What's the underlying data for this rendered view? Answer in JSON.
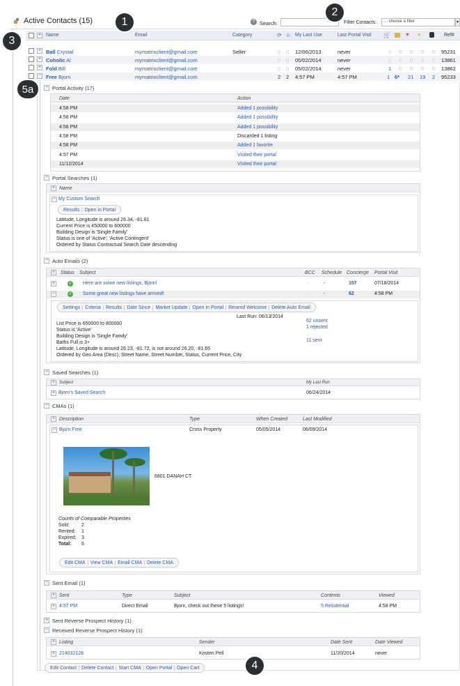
{
  "window": {
    "title": "Active Contacts (15)"
  },
  "search": {
    "label": "Search:",
    "value": ""
  },
  "filter": {
    "label": "Filter Contacts:",
    "selected": "... choose a filter"
  },
  "badges": [
    "1",
    "2",
    "3",
    "4",
    "5a"
  ],
  "columns": {
    "name": "Name",
    "email": "Email",
    "category": "Category",
    "my_last_use": "My Last Use",
    "last_portal_visit": "Last Portal Visit",
    "ref": "Ref#"
  },
  "contacts": [
    {
      "last": "Ball",
      "first": "Crystal",
      "email": "mymatrixclient@gmail.com",
      "category": "Seller",
      "c1": "0",
      "c2": "0",
      "my_last_use": "12/06/2013",
      "last_visit": "never",
      "s1": "0",
      "s2": "0",
      "s3": "0",
      "s4": "0",
      "s5": "0",
      "ref": "95231"
    },
    {
      "last": "Coholic",
      "first": "Al",
      "email": "mymatrixclient@gmail.com",
      "category": "",
      "c1": "0",
      "c2": "0",
      "my_last_use": "05/02/2014",
      "last_visit": "never",
      "s1": "0",
      "s2": "0",
      "s3": "0",
      "s4": "0",
      "s5": "0",
      "ref": "13861"
    },
    {
      "last": "Fold",
      "first": "Bill",
      "email": "mymatrixclient@gmail.com",
      "category": "",
      "c1": "0",
      "c2": "0",
      "my_last_use": "05/02/2014",
      "last_visit": "never",
      "s1": "1",
      "s2": "0",
      "s3": "0",
      "s4": "0",
      "s5": "0",
      "ref": "13862"
    },
    {
      "last": "Free",
      "first": "Bjorn",
      "email": "mymatrixclient@gmail.com",
      "category": "",
      "c1": "2",
      "c2": "2",
      "my_last_use": "4:57 PM",
      "last_visit": "4:57 PM",
      "s1": "1",
      "s2": "6*",
      "s3": "21",
      "s4": "19",
      "s5": "2",
      "ref": "95233"
    }
  ],
  "portal_activity": {
    "heading": "Portal Activity (17)",
    "col_date": "Date",
    "col_action": "Action",
    "rows": [
      {
        "date": "4:58 PM",
        "action": "Added 1 possibility"
      },
      {
        "date": "4:58 PM",
        "action": "Added 1 possibility"
      },
      {
        "date": "4:58 PM",
        "action": "Added 1 possibility"
      },
      {
        "date": "4:58 PM",
        "action": "Discarded 1 listing"
      },
      {
        "date": "4:58 PM",
        "action": "Added 1 favorite"
      },
      {
        "date": "4:57 PM",
        "action": "Visited their portal"
      },
      {
        "date": "11/12/2014",
        "action": "Visited their portal"
      }
    ]
  },
  "portal_searches": {
    "heading": "Portal Searches (1)",
    "col_name": "Name",
    "search_name": "My Custom Search",
    "buttons": [
      "Results",
      "Open in Portal"
    ],
    "criteria": [
      "Latitude, Longitude is around 26.34, -81.81",
      "Current Price is 450000 to 600000",
      "Building Design is 'Single Family'",
      "Status is one of 'Active', 'Active Contingent'",
      "Ordered by Status Contractual Search Date descending"
    ]
  },
  "auto_emails": {
    "heading": "Auto Emails (2)",
    "cols": {
      "status": "Status",
      "subject": "Subject",
      "bcc": "BCC",
      "schedule": "Schedule",
      "concierge": "Concierge",
      "portal_visit": "Portal Visit"
    },
    "rows": [
      {
        "subject": "Here are some new listings, Bjorn!",
        "bcc": "-",
        "schedule": "-",
        "concierge": "157",
        "portal_visit": "07/18/2014"
      },
      {
        "subject": "Some great new listings have arrived!",
        "bcc": "-",
        "schedule": "-",
        "concierge": "62",
        "portal_visit": "4:58 PM"
      }
    ],
    "buttons": [
      "Settings",
      "Criteria",
      "Results",
      "Date Since",
      "Market Update",
      "Open in Portal",
      "Resend Welcome",
      "Delete Auto Email"
    ],
    "last_run": "Last Run: 06/13/2014",
    "criteria": [
      "List Price is 650000 to 800000",
      "Status is 'Active'",
      "Building Design is 'Single Family'",
      "Baths Full is 3+",
      "Latitude, Longitude is around 26.23, -81.72, is not around 26.20, -81.65",
      "Ordered by Geo Area (Desc), Street Name, Street Number, Status, Current Price, City"
    ],
    "unsent": "62 unsent",
    "rejected": "1 rejected",
    "sent": "11 sent"
  },
  "saved_searches": {
    "heading": "Saved Searches (1)",
    "col_subject": "Subject",
    "col_last_run": "My Last Run",
    "name": "Bjorn's Saved Search",
    "last_run": "06/24/2014"
  },
  "cmas": {
    "heading": "CMAs (1)",
    "cols": {
      "description": "Description",
      "type": "Type",
      "created": "When Created",
      "modified": "Last Modified"
    },
    "row": {
      "description": "Bjorn Free",
      "type": "Cross Property",
      "created": "05/05/2014",
      "modified": "06/09/2014"
    },
    "address": "6801 DANAH CT",
    "counts_title": "Counts of Comparable Properties",
    "counts": [
      {
        "label": "Sold:",
        "value": "2"
      },
      {
        "label": "Rented:",
        "value": "1"
      },
      {
        "label": "Expired:",
        "value": "3"
      },
      {
        "label": "Total:",
        "value": "6"
      }
    ],
    "buttons": [
      "Edit CMA",
      "View CMA",
      "Email CMA",
      "Delete CMA"
    ]
  },
  "sent_email": {
    "heading": "Sent Email (1)",
    "cols": {
      "sent": "Sent",
      "type": "Type",
      "subject": "Subject",
      "contents": "Contents",
      "viewed": "Viewed"
    },
    "row": {
      "sent": "4:57 PM",
      "type": "Direct Email",
      "subject": "Bjorn, check out these 5 listings!",
      "contents": "5 Residential",
      "viewed": "4:58 PM"
    }
  },
  "sent_reverse": {
    "heading": "Sent Reverse Prospect History (1)"
  },
  "received_reverse": {
    "heading": "Received Reverse Prospect History (1)",
    "cols": {
      "listing": "Listing",
      "sender": "Sender",
      "date_sent": "Date Sent",
      "date_viewed": "Date Viewed"
    },
    "row": {
      "listing": "214032128",
      "sender": "Kristen Pell",
      "date_sent": "11/20/2014",
      "date_viewed": "never"
    }
  },
  "footer_buttons": [
    "Edit Contact",
    "Delete Contact",
    "Start CMA",
    "Open Portal",
    "Open Cart"
  ]
}
